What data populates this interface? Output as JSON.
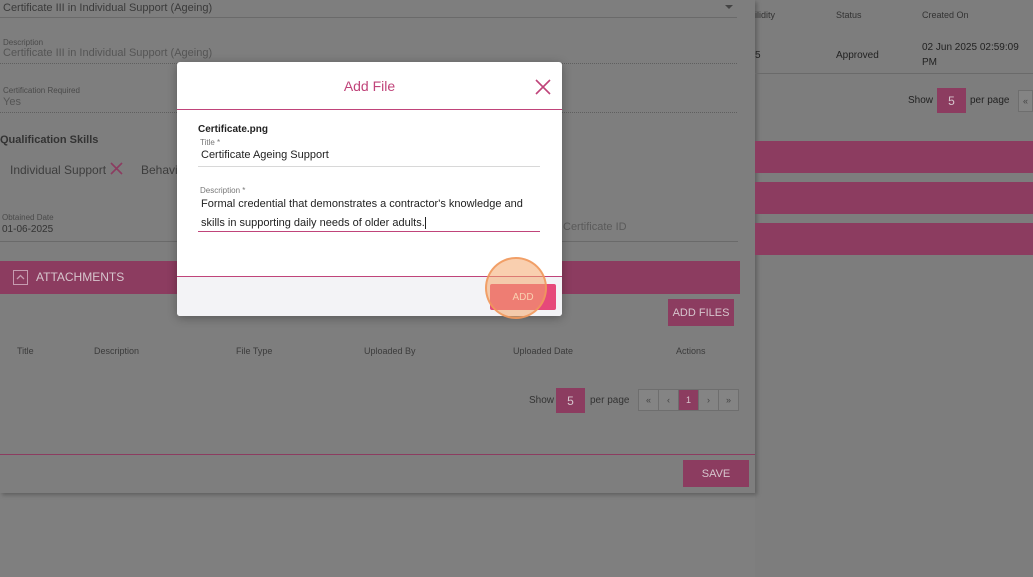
{
  "background": {
    "qualification_select": "Certificate III in Individual Support (Ageing)",
    "description_label": "Description",
    "description_value": "Certificate III in Individual Support (Ageing)",
    "cert_required_label": "Certification Required",
    "cert_required_value": "Yes",
    "skills_heading": "Qualification Skills",
    "skills": [
      "Individual Support",
      "Behavi"
    ],
    "obtained_date_label": "Obtained Date",
    "obtained_date_value": "01-06-2025",
    "certificate_id_placeholder": "Certificate ID",
    "attachments_heading": "ATTACHMENTS",
    "add_files_label": "ADD FILES",
    "table_headers": [
      "Title",
      "Description",
      "File Type",
      "Uploaded By",
      "Uploaded Date",
      "Actions"
    ],
    "pagination": {
      "show": "Show",
      "per_page_value": "5",
      "per_page": "per page",
      "first": "«",
      "prev": "‹",
      "page": "1",
      "next": "›",
      "last": "»"
    },
    "save_label": "SAVE",
    "right_table": {
      "headers": [
        "ilidity",
        "Status",
        "Created On"
      ],
      "row": {
        "validity": "5",
        "status": "Approved",
        "created_on_line1": "02 Jun 2025 02:59:09",
        "created_on_line2": "PM"
      },
      "pagination": {
        "show": "Show",
        "per_page_value": "5",
        "per_page": "per page",
        "first": "«"
      }
    }
  },
  "modal": {
    "title": "Add File",
    "file_name": "Certificate.png",
    "title_label": "Title *",
    "title_value": "Certificate Ageing Support",
    "description_label": "Description *",
    "description_value": "Formal credential that demonstrates a contractor's knowledge and skills in supporting daily needs of older adults.",
    "add_label": "ADD"
  },
  "colors": {
    "accent": "#c0447a",
    "add_button": "#e6497a",
    "dim_accent": "#8c3c60"
  },
  "icons": {
    "close": "close-icon",
    "remove_skill": "close-icon",
    "collapse": "chevron-up-icon",
    "dropdown": "chevron-down-icon"
  }
}
